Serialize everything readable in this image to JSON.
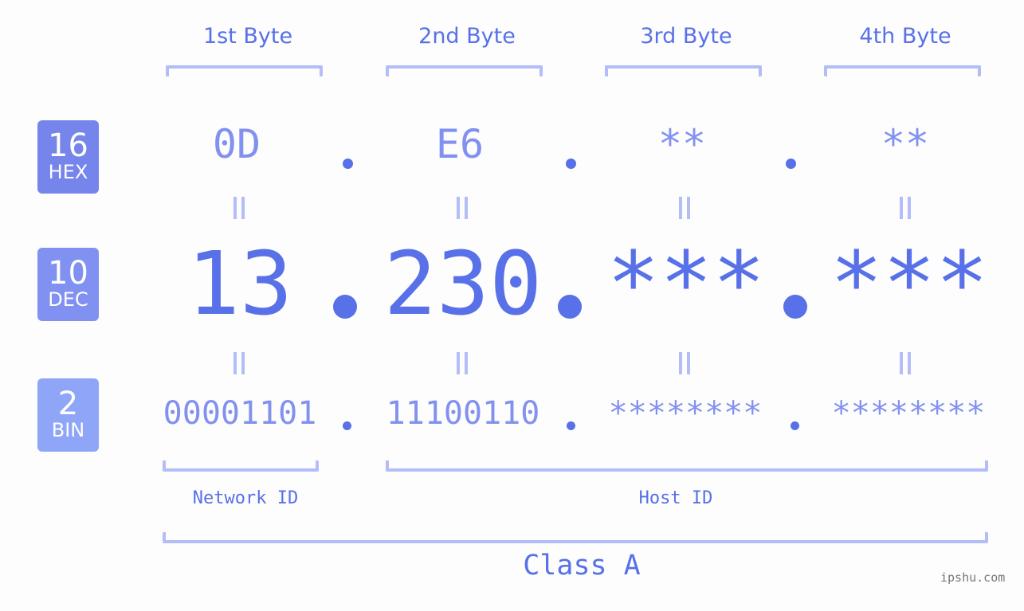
{
  "bytes": [
    {
      "label": "1st Byte",
      "hex": "0D",
      "dec": "13",
      "bin": "00001101"
    },
    {
      "label": "2nd Byte",
      "hex": "E6",
      "dec": "230",
      "bin": "11100110"
    },
    {
      "label": "3rd Byte",
      "hex": "**",
      "dec": "***",
      "bin": "********"
    },
    {
      "label": "4th Byte",
      "hex": "**",
      "dec": "***",
      "bin": "********"
    }
  ],
  "badges": {
    "hex": {
      "num": "16",
      "label": "HEX",
      "color": "#7585ec"
    },
    "dec": {
      "num": "10",
      "label": "DEC",
      "color": "#8091f1"
    },
    "bin": {
      "num": "2",
      "label": "BIN",
      "color": "#8fa5f8"
    }
  },
  "segments": {
    "network": "Network ID",
    "host": "Host ID"
  },
  "class_label": "Class A",
  "watermark": "ipshu.com",
  "colors": {
    "accent": "#5870e8",
    "light": "#8291ef",
    "bracket": "#b3bdf7"
  }
}
